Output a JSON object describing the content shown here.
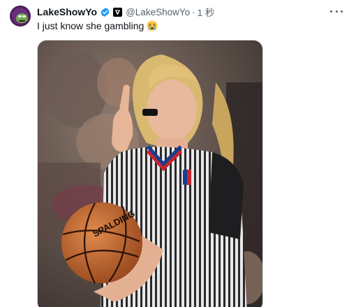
{
  "tweet": {
    "display_name": "LakeShowYo",
    "handle": "@LakeShowYo",
    "separator": "·",
    "timestamp": "1 秒",
    "text": "I just know she gambling",
    "emoji": "crying-face"
  },
  "media": {
    "type": "photo",
    "ball_brand": "SPALDING"
  },
  "colors": {
    "verified": "#1d9bf0",
    "secondary_text": "#536471",
    "primary_text": "#0f1419"
  }
}
